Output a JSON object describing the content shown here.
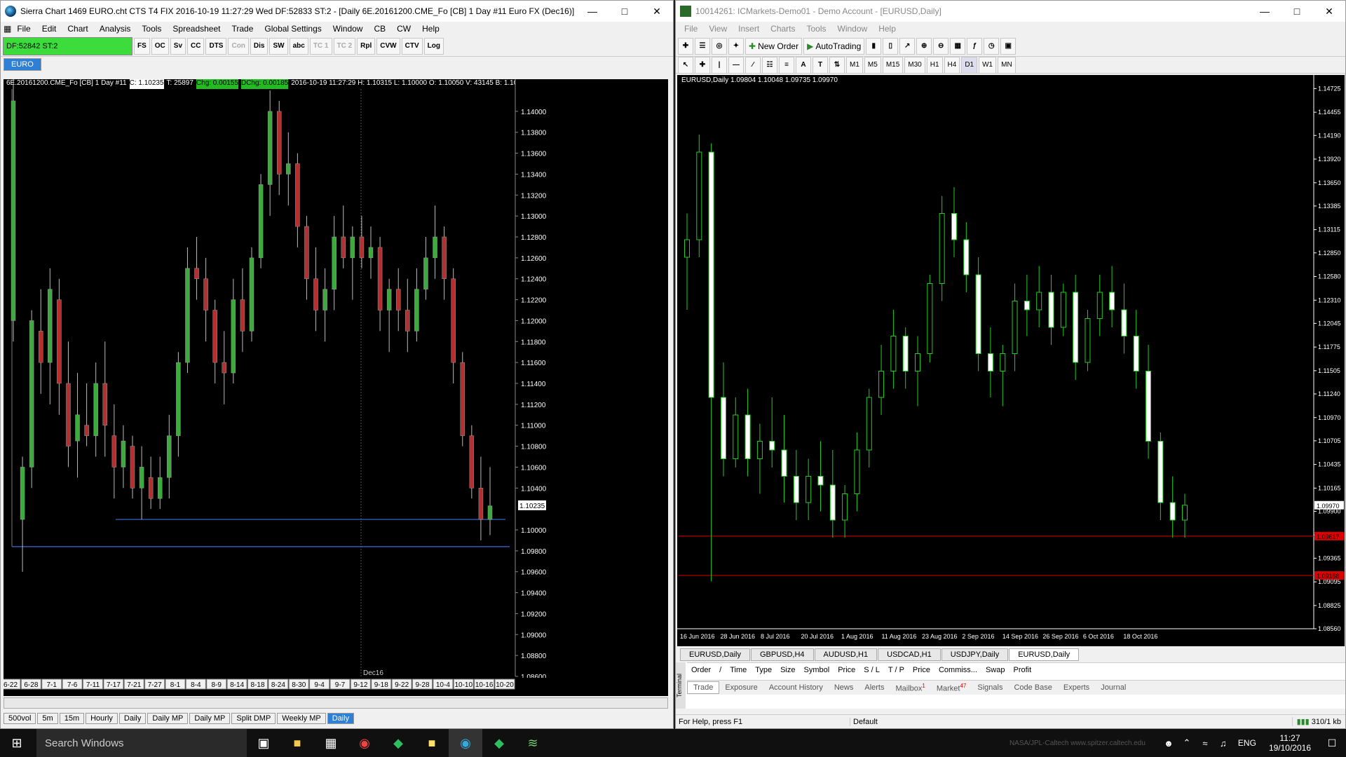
{
  "sierra": {
    "title": "Sierra Chart 1469 EURO.cht  CTS T4 FIX 2016-10-19  11:27:29 Wed  DF:52833  ST:2 - [Daily  6E.20161200.CME_Fo [CB]  1 Day  #11  Euro FX (Dec16)]",
    "menu": [
      "File",
      "Edit",
      "Chart",
      "Analysis",
      "Tools",
      "Spreadsheet",
      "Trade",
      "Global Settings",
      "Window",
      "CB",
      "CW",
      "Help"
    ],
    "status": "DF:52842  ST:2",
    "toolbar": [
      "FS",
      "OC",
      "Sv",
      "CC",
      "DTS",
      "Con",
      "Dis",
      "SW",
      "abc",
      "TC 1",
      "TC 2",
      "Rpl",
      "CVW",
      "CTV",
      "Log"
    ],
    "chart_tab": "EURO",
    "info": {
      "symbol": "6E.20161200.CME_Fo [CB]  1 Day  #11",
      "close": "C: 1.10235",
      "t": "T: 25897",
      "chg": "Chg: 0.00155",
      "dchg": "DChg: 0.00185",
      "rest": "2016-10-19  11:27:29  H: 1.10315  L: 1.10000  O: 1.10050  V: 43145  B: 1.10235  A: 1.10240  3x4"
    },
    "price_labels": [
      "1.14000",
      "1.13800",
      "1.13600",
      "1.13400",
      "1.13200",
      "1.13000",
      "1.12800",
      "1.12600",
      "1.12400",
      "1.12200",
      "1.12000",
      "1.11800",
      "1.11600",
      "1.11400",
      "1.11200",
      "1.11000",
      "1.10800",
      "1.10600",
      "1.10400",
      "1.10000",
      "1.09800",
      "1.09600",
      "1.09400",
      "1.09200",
      "1.09000",
      "1.08800",
      "1.08600"
    ],
    "current_price": "1.10235",
    "contract_label": "Dec16",
    "date_labels": [
      "6-22",
      "6-28",
      "7-1",
      "7-6",
      "7-11",
      "7-17",
      "7-21",
      "7-27",
      "8-1",
      "8-4",
      "8-9",
      "8-14",
      "8-18",
      "8-24",
      "8-30",
      "9-4",
      "9-7",
      "9-12",
      "9-18",
      "9-22",
      "9-28",
      "10-4",
      "10-10",
      "10-16",
      "10-20"
    ],
    "bottom_buttons": [
      "500vol",
      "5m",
      "15m",
      "Hourly",
      "Daily",
      "Daily MP",
      "Daily MP",
      "Split DMP",
      "Weekly MP",
      "Daily"
    ]
  },
  "mt4": {
    "title": "10014261: ICMarkets-Demo01 - Demo Account - [EURUSD,Daily]",
    "menu": [
      "File",
      "View",
      "Insert",
      "Charts",
      "Tools",
      "Window",
      "Help"
    ],
    "new_order": "New Order",
    "auto_trading": "AutoTrading",
    "timeframes": [
      "M1",
      "M5",
      "M15",
      "M30",
      "H1",
      "H4",
      "D1",
      "W1",
      "MN"
    ],
    "chart_header": "EURUSD,Daily  1.09804 1.10048 1.09735 1.09970",
    "price_labels": [
      "1.14725",
      "1.14455",
      "1.14190",
      "1.13920",
      "1.13650",
      "1.13385",
      "1.13115",
      "1.12850",
      "1.12580",
      "1.12310",
      "1.12045",
      "1.11775",
      "1.11505",
      "1.11240",
      "1.10970",
      "1.10705",
      "1.10435",
      "1.10165",
      "1.09900",
      "1.09630",
      "1.09365",
      "1.09095",
      "1.08825",
      "1.08560"
    ],
    "current_price": "1.09970",
    "red_price_upper": "1.09617",
    "red_price_lower": "1.09168",
    "date_labels": [
      "16 Jun 2016",
      "28 Jun 2016",
      "8 Jul 2016",
      "20 Jul 2016",
      "1 Aug 2016",
      "11 Aug 2016",
      "23 Aug 2016",
      "2 Sep 2016",
      "14 Sep 2016",
      "26 Sep 2016",
      "6 Oct 2016",
      "18 Oct 2016"
    ],
    "chart_tabs": [
      "EURUSD,Daily",
      "GBPUSD,H4",
      "AUDUSD,H1",
      "USDCAD,H1",
      "USDJPY,Daily",
      "EURUSD,Daily"
    ],
    "terminal_columns": [
      "Order",
      "/",
      "Time",
      "Type",
      "Size",
      "Symbol",
      "Price",
      "S / L",
      "T / P",
      "Price",
      "Commiss...",
      "Swap",
      "Profit"
    ],
    "terminal_tabs": [
      "Trade",
      "Exposure",
      "Account History",
      "News",
      "Alerts",
      "Mailbox",
      "Market",
      "Signals",
      "Code Base",
      "Experts",
      "Journal"
    ],
    "mailbox_count": "1",
    "market_count": "47",
    "terminal_side": "Terminal",
    "status_help": "For Help, press F1",
    "status_profile": "Default",
    "status_conn": "310/1 kb"
  },
  "taskbar": {
    "search": "Search Windows",
    "watermark": "NASA/JPL-Caltech   www.spitzer.caltech.edu",
    "lang": "ENG",
    "time": "11:27",
    "date": "19/10/2016"
  },
  "chart_data": [
    {
      "type": "candlestick",
      "title": "6E.20161200.CME_Fo [CB] 1 Day #11",
      "ylim": [
        1.086,
        1.142
      ],
      "candles": [
        [
          1.12,
          1.144,
          1.118,
          1.141
        ],
        [
          1.101,
          1.107,
          1.096,
          1.106
        ],
        [
          1.106,
          1.121,
          1.104,
          1.12
        ],
        [
          1.119,
          1.123,
          1.113,
          1.116
        ],
        [
          1.116,
          1.125,
          1.112,
          1.123
        ],
        [
          1.122,
          1.124,
          1.111,
          1.114
        ],
        [
          1.114,
          1.118,
          1.106,
          1.108
        ],
        [
          1.1085,
          1.115,
          1.105,
          1.111
        ],
        [
          1.11,
          1.114,
          1.108,
          1.109
        ],
        [
          1.109,
          1.116,
          1.107,
          1.114
        ],
        [
          1.114,
          1.118,
          1.107,
          1.11
        ],
        [
          1.109,
          1.112,
          1.103,
          1.106
        ],
        [
          1.106,
          1.11,
          1.104,
          1.1085
        ],
        [
          1.108,
          1.109,
          1.103,
          1.104
        ],
        [
          1.104,
          1.108,
          1.101,
          1.106
        ],
        [
          1.105,
          1.107,
          1.102,
          1.103
        ],
        [
          1.103,
          1.107,
          1.102,
          1.105
        ],
        [
          1.105,
          1.111,
          1.103,
          1.109
        ],
        [
          1.109,
          1.117,
          1.107,
          1.116
        ],
        [
          1.116,
          1.127,
          1.115,
          1.125
        ],
        [
          1.125,
          1.128,
          1.122,
          1.124
        ],
        [
          1.124,
          1.126,
          1.118,
          1.121
        ],
        [
          1.121,
          1.122,
          1.114,
          1.116
        ],
        [
          1.116,
          1.119,
          1.112,
          1.115
        ],
        [
          1.115,
          1.124,
          1.114,
          1.122
        ],
        [
          1.122,
          1.125,
          1.117,
          1.119
        ],
        [
          1.119,
          1.127,
          1.118,
          1.126
        ],
        [
          1.126,
          1.134,
          1.125,
          1.133
        ],
        [
          1.133,
          1.142,
          1.13,
          1.14
        ],
        [
          1.14,
          1.141,
          1.132,
          1.134
        ],
        [
          1.134,
          1.138,
          1.131,
          1.135
        ],
        [
          1.135,
          1.136,
          1.127,
          1.129
        ],
        [
          1.129,
          1.13,
          1.122,
          1.124
        ],
        [
          1.124,
          1.127,
          1.119,
          1.121
        ],
        [
          1.121,
          1.125,
          1.118,
          1.123
        ],
        [
          1.123,
          1.13,
          1.121,
          1.128
        ],
        [
          1.128,
          1.131,
          1.125,
          1.126
        ],
        [
          1.126,
          1.129,
          1.122,
          1.128
        ],
        [
          1.128,
          1.13,
          1.125,
          1.126
        ],
        [
          1.126,
          1.129,
          1.124,
          1.127
        ],
        [
          1.127,
          1.128,
          1.119,
          1.121
        ],
        [
          1.121,
          1.124,
          1.117,
          1.123
        ],
        [
          1.123,
          1.125,
          1.119,
          1.121
        ],
        [
          1.121,
          1.124,
          1.117,
          1.119
        ],
        [
          1.119,
          1.125,
          1.118,
          1.123
        ],
        [
          1.123,
          1.128,
          1.122,
          1.126
        ],
        [
          1.126,
          1.131,
          1.124,
          1.128
        ],
        [
          1.128,
          1.129,
          1.122,
          1.124
        ],
        [
          1.124,
          1.125,
          1.114,
          1.116
        ],
        [
          1.116,
          1.117,
          1.108,
          1.109
        ],
        [
          1.109,
          1.11,
          1.103,
          1.104
        ],
        [
          1.104,
          1.107,
          1.099,
          1.101
        ],
        [
          1.101,
          1.106,
          1.0995,
          1.1023
        ]
      ]
    },
    {
      "type": "candlestick",
      "title": "EURUSD,Daily",
      "ylim": [
        1.0856,
        1.148
      ],
      "candles": [
        [
          1.128,
          1.133,
          1.122,
          1.13
        ],
        [
          1.13,
          1.142,
          1.128,
          1.14
        ],
        [
          1.14,
          1.141,
          1.091,
          1.112
        ],
        [
          1.112,
          1.116,
          1.103,
          1.105
        ],
        [
          1.105,
          1.112,
          1.104,
          1.11
        ],
        [
          1.11,
          1.113,
          1.103,
          1.105
        ],
        [
          1.105,
          1.109,
          1.101,
          1.107
        ],
        [
          1.107,
          1.112,
          1.104,
          1.106
        ],
        [
          1.106,
          1.11,
          1.1,
          1.103
        ],
        [
          1.103,
          1.106,
          1.098,
          1.1
        ],
        [
          1.1,
          1.105,
          1.098,
          1.103
        ],
        [
          1.103,
          1.107,
          1.099,
          1.102
        ],
        [
          1.102,
          1.106,
          1.096,
          1.098
        ],
        [
          1.098,
          1.102,
          1.096,
          1.101
        ],
        [
          1.101,
          1.108,
          1.099,
          1.106
        ],
        [
          1.106,
          1.113,
          1.104,
          1.112
        ],
        [
          1.112,
          1.118,
          1.11,
          1.115
        ],
        [
          1.115,
          1.122,
          1.113,
          1.119
        ],
        [
          1.119,
          1.12,
          1.113,
          1.115
        ],
        [
          1.115,
          1.119,
          1.111,
          1.117
        ],
        [
          1.117,
          1.126,
          1.116,
          1.125
        ],
        [
          1.125,
          1.135,
          1.123,
          1.133
        ],
        [
          1.133,
          1.136,
          1.128,
          1.13
        ],
        [
          1.13,
          1.132,
          1.124,
          1.126
        ],
        [
          1.126,
          1.128,
          1.115,
          1.117
        ],
        [
          1.117,
          1.12,
          1.112,
          1.115
        ],
        [
          1.115,
          1.118,
          1.111,
          1.117
        ],
        [
          1.117,
          1.125,
          1.115,
          1.123
        ],
        [
          1.123,
          1.126,
          1.119,
          1.122
        ],
        [
          1.122,
          1.127,
          1.12,
          1.124
        ],
        [
          1.124,
          1.126,
          1.118,
          1.12
        ],
        [
          1.12,
          1.125,
          1.119,
          1.124
        ],
        [
          1.124,
          1.126,
          1.114,
          1.116
        ],
        [
          1.116,
          1.122,
          1.115,
          1.121
        ],
        [
          1.121,
          1.126,
          1.119,
          1.124
        ],
        [
          1.124,
          1.127,
          1.12,
          1.122
        ],
        [
          1.122,
          1.125,
          1.117,
          1.119
        ],
        [
          1.119,
          1.122,
          1.113,
          1.115
        ],
        [
          1.115,
          1.118,
          1.105,
          1.107
        ],
        [
          1.107,
          1.108,
          1.098,
          1.1
        ],
        [
          1.1,
          1.103,
          1.096,
          1.098
        ],
        [
          1.098,
          1.101,
          1.096,
          1.0997
        ]
      ]
    }
  ]
}
